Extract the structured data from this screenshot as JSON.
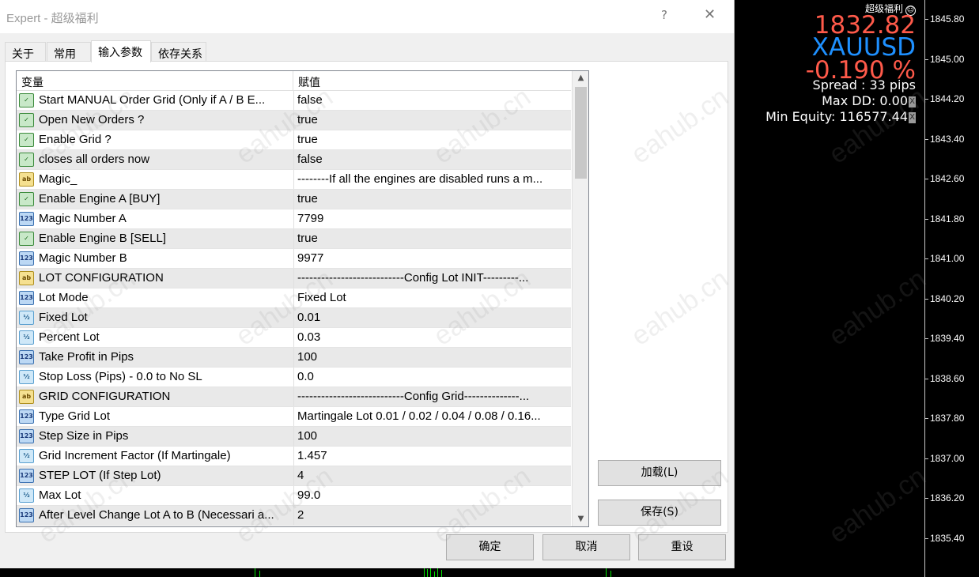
{
  "dialog": {
    "title": "Expert - 超级福利",
    "help_label": "?",
    "close_label": "✕",
    "tabs": [
      {
        "label": "关于"
      },
      {
        "label": "常用"
      },
      {
        "label": "输入参数",
        "active": true
      },
      {
        "label": "依存关系"
      }
    ],
    "table": {
      "columns": [
        "变量",
        "赋值"
      ],
      "rows": [
        {
          "type": "bool",
          "icon": "boolean-icon",
          "name": "Start MANUAL Order  Grid  (Only if A / B E...",
          "value": "false"
        },
        {
          "type": "bool",
          "icon": "boolean-icon",
          "name": "Open New Orders ?",
          "value": "true"
        },
        {
          "type": "bool",
          "icon": "boolean-icon",
          "name": "Enable Grid ?",
          "value": "true"
        },
        {
          "type": "bool",
          "icon": "boolean-icon",
          "name": "closes all orders now",
          "value": "false"
        },
        {
          "type": "str",
          "icon": "string-icon",
          "name": "Magic_",
          "value": "--------If all the engines are disabled runs a m..."
        },
        {
          "type": "bool",
          "icon": "boolean-icon",
          "name": "Enable Engine A   [BUY]",
          "value": "true"
        },
        {
          "type": "int",
          "icon": "integer-icon",
          "name": "Magic Number  A",
          "value": "7799"
        },
        {
          "type": "bool",
          "icon": "boolean-icon",
          "name": "Enable Engine B   [SELL]",
          "value": "true"
        },
        {
          "type": "int",
          "icon": "integer-icon",
          "name": "Magic Number  B",
          "value": "9977"
        },
        {
          "type": "str",
          "icon": "string-icon",
          "name": "LOT CONFIGURATION",
          "value": "---------------------------Config Lot INIT---------..."
        },
        {
          "type": "int",
          "icon": "integer-icon",
          "name": "Lot Mode",
          "value": "Fixed Lot"
        },
        {
          "type": "dbl",
          "icon": "double-icon",
          "name": "Fixed Lot",
          "value": "0.01"
        },
        {
          "type": "dbl",
          "icon": "double-icon",
          "name": "Percent Lot",
          "value": "0.03"
        },
        {
          "type": "int",
          "icon": "integer-icon",
          "name": "Take Profit in Pips",
          "value": "100"
        },
        {
          "type": "dbl",
          "icon": "double-icon",
          "name": "Stop Loss (Pips) - 0.0 to No SL",
          "value": "0.0"
        },
        {
          "type": "str",
          "icon": "string-icon",
          "name": "GRID CONFIGURATION",
          "value": "---------------------------Config Grid--------------..."
        },
        {
          "type": "int",
          "icon": "integer-icon",
          "name": "Type Grid Lot",
          "value": "Martingale Lot  0.01 / 0.02 / 0.04 / 0.08 / 0.16..."
        },
        {
          "type": "int",
          "icon": "integer-icon",
          "name": "Step Size in Pips",
          "value": "100"
        },
        {
          "type": "dbl",
          "icon": "double-icon",
          "name": "Grid Increment Factor (If Martingale)",
          "value": "1.457"
        },
        {
          "type": "int",
          "icon": "integer-icon",
          "name": "STEP LOT (If  Step Lot)",
          "value": "4"
        },
        {
          "type": "dbl",
          "icon": "double-icon",
          "name": "Max Lot",
          "value": "99.0"
        },
        {
          "type": "int",
          "icon": "integer-icon",
          "name": "After Level Change Lot A to B (Necessari a...",
          "value": "2"
        }
      ]
    },
    "buttons": {
      "load": "加载(L)",
      "save": "保存(S)",
      "ok": "确定",
      "cancel": "取消",
      "reset": "重设"
    },
    "watermark": "eahub.cn"
  },
  "chart": {
    "ea_name": "超级福利",
    "price": "1832.82",
    "symbol": "XAUUSD",
    "change": "-0.190 %",
    "spread": "Spread : 33 pips",
    "max_dd": "Max DD: 0.00",
    "min_equity": "Min Equity: 116577.44",
    "x_mark": "X",
    "price_ticks": [
      "1845.80",
      "1845.00",
      "1844.20",
      "1843.40",
      "1842.60",
      "1841.80",
      "1841.00",
      "1840.20",
      "1839.40",
      "1838.60",
      "1837.80",
      "1837.00",
      "1836.20",
      "1835.40"
    ],
    "colors": {
      "price": "#ff5a4a",
      "symbol": "#1e90ff",
      "candles": "#00e000"
    }
  }
}
